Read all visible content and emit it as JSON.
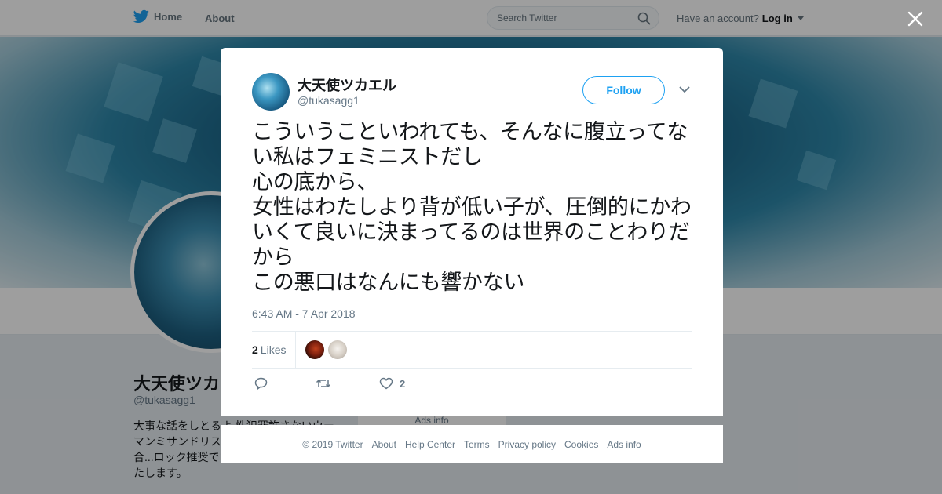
{
  "topbar": {
    "home_label": "Home",
    "about_label": "About",
    "search_placeholder": "Search Twitter",
    "account_prompt": "Have an account?",
    "login_label": "Log in"
  },
  "profile": {
    "name": "大天使ツカエル",
    "handle": "@tukasagg1",
    "bio": "大事な話をしとるよ 性犯罪許さないウーマンミサンドリスト...んしますので、合...ロック推奨です。よろしくお願いいたします。",
    "ads_label": "Ads info"
  },
  "tweet": {
    "author_name": "大天使ツカエル",
    "author_handle": "@tukasagg1",
    "follow_label": "Follow",
    "text": "こういうこといわれても、そんなに腹立ってない私はフェミニストだし\n心の底から、\n女性はわたしより背が低い子が、圧倒的にかわいくて良いに決まってるのは世界のことわりだから\nこの悪口はなんにも響かない",
    "timestamp": "6:43 AM - 7 Apr 2018",
    "likes_count": "2",
    "likes_label": "Likes",
    "action_like_count": "2"
  },
  "footer": {
    "links": [
      "© 2019 Twitter",
      "About",
      "Help Center",
      "Terms",
      "Privacy policy",
      "Cookies",
      "Ads info"
    ]
  },
  "colors": {
    "accent": "#1da1f2",
    "text_secondary": "#657786"
  }
}
